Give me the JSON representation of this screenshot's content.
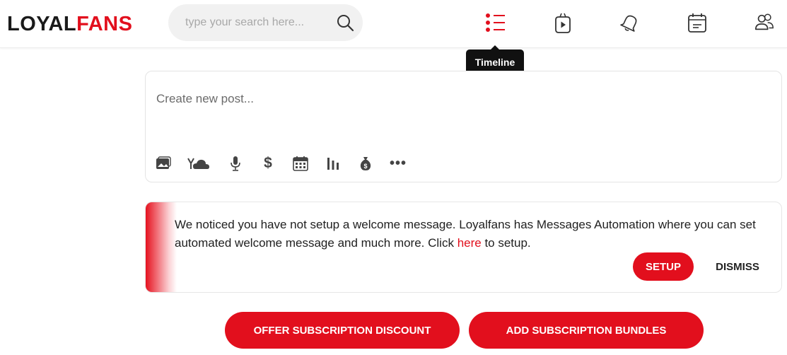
{
  "header": {
    "logo_part1": "LOYAL",
    "logo_part2": "FANS",
    "search": {
      "placeholder": "type your search here...",
      "value": "",
      "icon": "search-icon"
    },
    "nav": [
      {
        "name": "timeline",
        "icon": "timeline-list-icon",
        "active": true
      },
      {
        "name": "videos",
        "icon": "video-bag-icon",
        "active": false
      },
      {
        "name": "notifications",
        "icon": "bell-icon",
        "active": false
      },
      {
        "name": "calendar",
        "icon": "calendar-icon",
        "active": false
      },
      {
        "name": "users",
        "icon": "users-icon",
        "active": false
      }
    ],
    "tooltip": "Timeline"
  },
  "composer": {
    "placeholder": "Create new post...",
    "tools": [
      "image-icon",
      "cloud-icon",
      "microphone-icon",
      "dollar-icon",
      "calendar-icon",
      "poll-icon",
      "money-bag-icon",
      "more-icon"
    ],
    "dollar_symbol": "$",
    "more_symbol": "•••"
  },
  "notice": {
    "text_before": "We noticed you have not setup a welcome message. Loyalfans has Messages Automation where you can set automated welcome message and much more. Click ",
    "link_text": "here",
    "text_after": " to setup.",
    "setup_label": "SETUP",
    "dismiss_label": "DISMISS"
  },
  "actions": {
    "offer_discount_label": "OFFER SUBSCRIPTION DISCOUNT",
    "add_bundles_label": "ADD SUBSCRIPTION BUNDLES"
  },
  "colors": {
    "accent": "#e20f1d",
    "tooltip_bg": "#111111"
  }
}
